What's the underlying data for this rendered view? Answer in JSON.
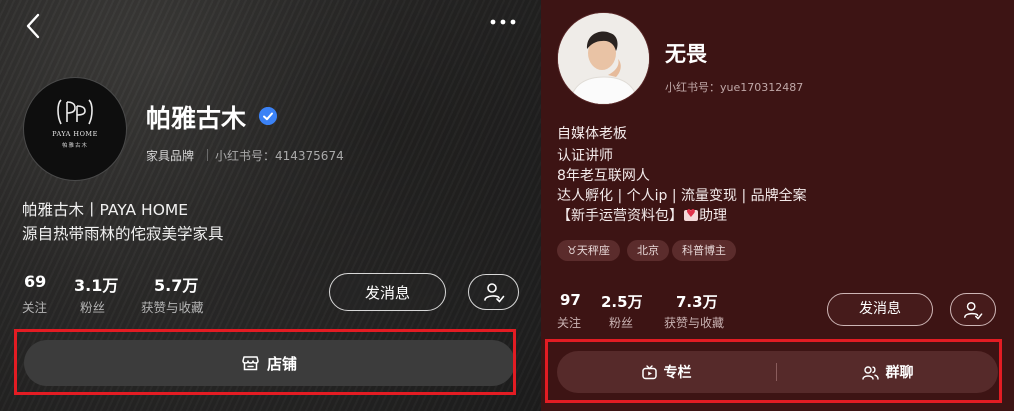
{
  "left_profile": {
    "name": "帕雅古木",
    "verified_icon": "verified-badge-icon",
    "category_tag": "家具品牌",
    "id_label": "小红书号：414375674",
    "avatar": {
      "logo_en": "PAYA HOME",
      "logo_cn": "帕雅古木"
    },
    "bio": [
      "帕雅古木丨PAYA HOME",
      "源自热带雨林的侘寂美学家具"
    ],
    "stats": [
      {
        "value": "69",
        "label": "关注"
      },
      {
        "value": "3.1万",
        "label": "粉丝"
      },
      {
        "value": "5.7万",
        "label": "获赞与收藏"
      }
    ],
    "message_button": "发消息",
    "shop_button": "店铺",
    "icons": {
      "back": "back-arrow-icon",
      "more": "more-dots-icon",
      "follow": "follow-user-icon",
      "shop": "shop-icon"
    }
  },
  "right_profile": {
    "name": "无畏",
    "id_label": "小红书号：yue170312487",
    "bio": [
      "自媒体老板",
      "认证讲师",
      "8年老互联网人",
      "达人孵化 | 个人ip | 流量变现 | 品牌全案",
      "【新手运营资料包】",
      "助理"
    ],
    "tags": [
      "♉天秤座",
      "北京",
      "科普博主"
    ],
    "stats": [
      {
        "value": "97",
        "label": "关注"
      },
      {
        "value": "2.5万",
        "label": "粉丝"
      },
      {
        "value": "7.3万",
        "label": "获赞与收藏"
      }
    ],
    "message_button": "发消息",
    "column_button": "专栏",
    "group_chat_button": "群聊",
    "icons": {
      "follow": "follow-user-icon",
      "column": "column-tv-icon",
      "group": "group-chat-icon",
      "heart": "heart-emoji-icon"
    }
  },
  "colors": {
    "highlight": "#e31c23",
    "verified": "#3b82f6",
    "right_bg": "#3d1414",
    "left_bg": "#2b2a29"
  }
}
